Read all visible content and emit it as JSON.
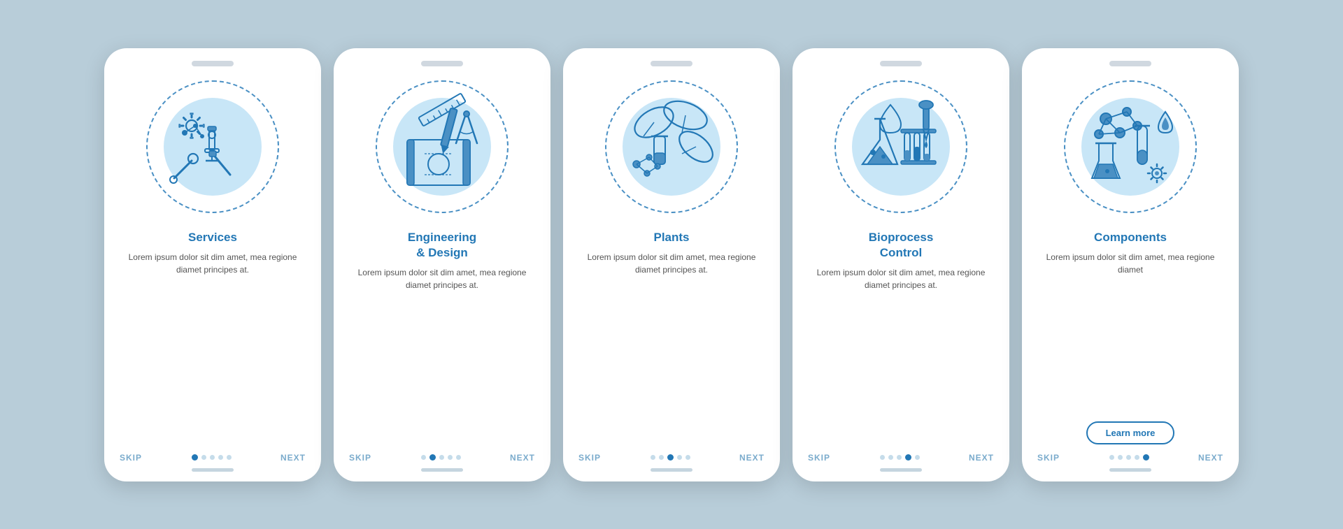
{
  "cards": [
    {
      "id": "services",
      "title": "Services",
      "description": "Lorem ipsum dolor sit dim amet, mea regione diamet principes at.",
      "show_learn_more": false,
      "active_dot": 0,
      "dots": [
        0,
        1,
        2,
        3,
        4
      ]
    },
    {
      "id": "engineering",
      "title": "Engineering\n& Design",
      "description": "Lorem ipsum dolor sit dim amet, mea regione diamet principes at.",
      "show_learn_more": false,
      "active_dot": 1,
      "dots": [
        0,
        1,
        2,
        3,
        4
      ]
    },
    {
      "id": "plants",
      "title": "Plants",
      "description": "Lorem ipsum dolor sit dim amet, mea regione diamet principes at.",
      "show_learn_more": false,
      "active_dot": 2,
      "dots": [
        0,
        1,
        2,
        3,
        4
      ]
    },
    {
      "id": "bioprocess",
      "title": "Bioprocess\nControl",
      "description": "Lorem ipsum dolor sit dim amet, mea regione diamet principes at.",
      "show_learn_more": false,
      "active_dot": 3,
      "dots": [
        0,
        1,
        2,
        3,
        4
      ]
    },
    {
      "id": "components",
      "title": "Components",
      "description": "Lorem ipsum dolor sit dim amet, mea regione diamet",
      "show_learn_more": true,
      "learn_more_label": "Learn more",
      "active_dot": 4,
      "dots": [
        0,
        1,
        2,
        3,
        4
      ]
    }
  ],
  "nav": {
    "skip": "SKIP",
    "next": "NEXT"
  }
}
